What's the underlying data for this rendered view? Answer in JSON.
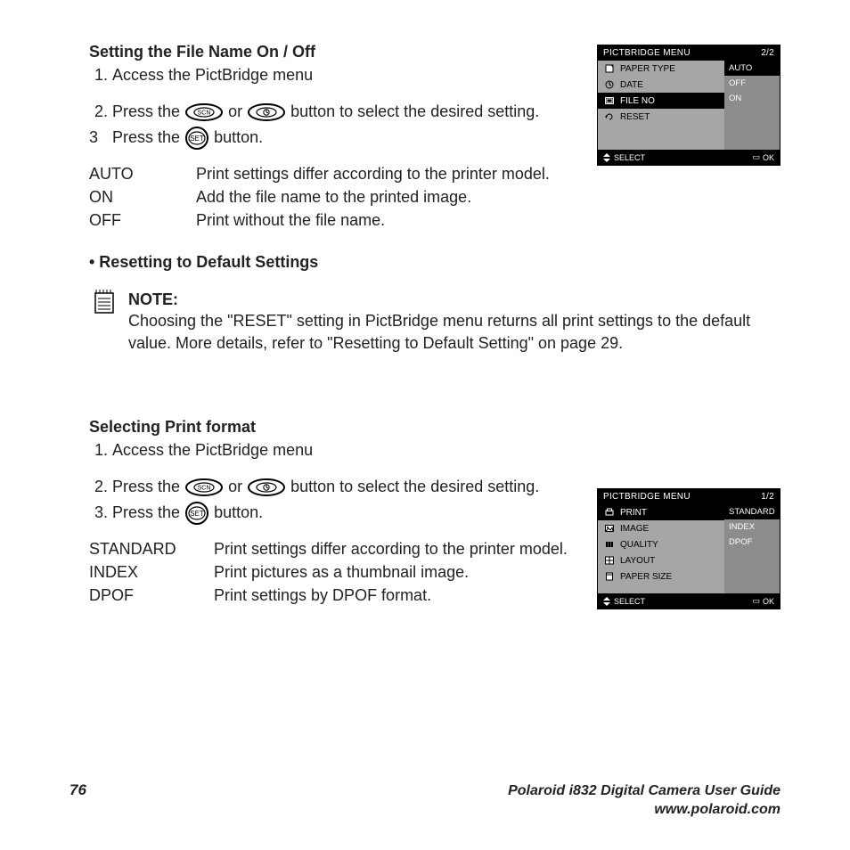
{
  "section1": {
    "heading": "Setting the File Name On / Off",
    "steps": [
      "Access the PictBridge menu",
      "Press the  SCN  or  TIMER  button to select the desired setting.",
      "Press the  SET  button."
    ],
    "step1": "Access the PictBridge menu",
    "step2_pre": "Press the ",
    "step2_mid": " or ",
    "step2_post": " button to select the desired setting.",
    "step3_pre": "Press the ",
    "step3_post": " button.",
    "step3_marker": "3",
    "defs": [
      {
        "term": "AUTO",
        "desc": "Print settings differ according to the printer model."
      },
      {
        "term": "ON",
        "desc": "Add the file name to the printed image."
      },
      {
        "term": "OFF",
        "desc": "Print without the file name."
      }
    ]
  },
  "reset_heading": "• Resetting to Default Settings",
  "note": {
    "label": "NOTE:",
    "body": "Choosing the \"RESET\" setting in PictBridge menu returns all print settings to the default value. More details, refer to \"Resetting to Default Setting\" on page 29."
  },
  "section2": {
    "heading": "Selecting Print format",
    "step1": "Access the PictBridge menu",
    "step2_pre": "Press the ",
    "step2_mid": " or ",
    "step2_post": " button to select the desired setting.",
    "step3_pre": "Press the ",
    "step3_post": " button.",
    "defs": [
      {
        "term": "STANDARD",
        "desc": "Print settings differ according to the printer model."
      },
      {
        "term": "INDEX",
        "desc": "Print pictures as a thumbnail image."
      },
      {
        "term": "DPOF",
        "desc": "Print settings by DPOF format."
      }
    ]
  },
  "footer": {
    "page": "76",
    "guide1": "Polaroid i832 Digital Camera User Guide",
    "guide2": "www.polaroid.com"
  },
  "lcd1": {
    "title": "PICTBRIDGE MENU",
    "page": "2/2",
    "items": [
      {
        "label": "PAPER TYPE",
        "icon": "paper"
      },
      {
        "label": "DATE",
        "icon": "date"
      },
      {
        "label": "FILE NO",
        "icon": "fileno",
        "selected": true
      },
      {
        "label": "RESET",
        "icon": "reset"
      }
    ],
    "options": [
      {
        "label": "AUTO",
        "selected": true
      },
      {
        "label": "OFF"
      },
      {
        "label": "ON"
      }
    ],
    "select": "SELECT",
    "ok": "OK"
  },
  "lcd2": {
    "title": "PICTBRIDGE MENU",
    "page": "1/2",
    "items": [
      {
        "label": "PRINT",
        "icon": "print",
        "selected": true
      },
      {
        "label": "IMAGE",
        "icon": "image"
      },
      {
        "label": "QUALITY",
        "icon": "quality"
      },
      {
        "label": "LAYOUT",
        "icon": "layout"
      },
      {
        "label": "PAPER SIZE",
        "icon": "papersize"
      }
    ],
    "options": [
      {
        "label": "STANDARD",
        "selected": true
      },
      {
        "label": "INDEX"
      },
      {
        "label": "DPOF"
      }
    ],
    "select": "SELECT",
    "ok": "OK"
  }
}
